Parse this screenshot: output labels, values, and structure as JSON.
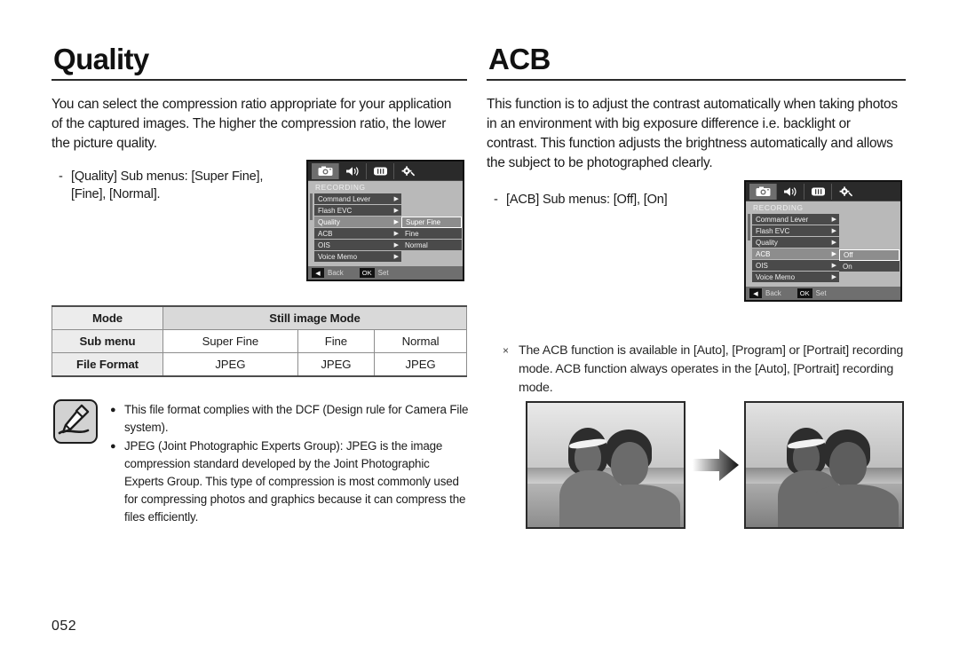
{
  "page": {
    "number": "052"
  },
  "left_section": {
    "title": "Quality",
    "intro": "You can select the compression ratio appropriate for your application of the captured images. The higher the compression ratio, the lower the picture quality.",
    "dash": "-",
    "submenu_line": "[Quality] Sub menus: [Super Fine], [Fine], [Normal]."
  },
  "right_section": {
    "title": "ACB",
    "intro": "This function is to adjust the contrast automatically when taking photos in an environment with big exposure difference i.e. backlight or contrast. This function adjusts the brightness automatically and allows the subject to be photographed clearly.",
    "dash": "-",
    "submenu_line": "[ACB] Sub menus: [Off], [On]",
    "note_mark": "×",
    "note_text": "The ACB function is available in [Auto], [Program] or [Portrait] recording mode. ACB function always operates in the [Auto], [Portrait] recording mode."
  },
  "lcd_quality": {
    "tabs": [
      {
        "icon": "camera-icon",
        "active": true
      },
      {
        "icon": "sound-icon",
        "active": false
      },
      {
        "icon": "display-icon",
        "active": false
      },
      {
        "icon": "settings-gear-icon",
        "active": false
      }
    ],
    "heading": "RECORDING",
    "rows": [
      {
        "label": "Command Lever",
        "caret": "▶",
        "selected": false
      },
      {
        "label": "Flash EVC",
        "caret": "▶",
        "selected": false
      },
      {
        "label": "Quality",
        "caret": "▶",
        "selected": true
      },
      {
        "label": "ACB",
        "caret": "▶",
        "selected": false
      },
      {
        "label": "OIS",
        "caret": "▶",
        "selected": false
      },
      {
        "label": "Voice Memo",
        "caret": "▶",
        "selected": false
      }
    ],
    "submenu": [
      {
        "label": "Super Fine",
        "selected": true
      },
      {
        "label": "Fine",
        "selected": false
      },
      {
        "label": "Normal",
        "selected": false
      }
    ],
    "footer": {
      "back_key": "◀",
      "back_label": "Back",
      "ok_key": "OK",
      "ok_label": "Set"
    }
  },
  "lcd_acb": {
    "tabs": [
      {
        "icon": "camera-icon",
        "active": true
      },
      {
        "icon": "sound-icon",
        "active": false
      },
      {
        "icon": "display-icon",
        "active": false
      },
      {
        "icon": "settings-gear-icon",
        "active": false
      }
    ],
    "heading": "RECORDING",
    "rows": [
      {
        "label": "Command Lever",
        "caret": "▶",
        "selected": false
      },
      {
        "label": "Flash EVC",
        "caret": "▶",
        "selected": false
      },
      {
        "label": "Quality",
        "caret": "▶",
        "selected": false
      },
      {
        "label": "ACB",
        "caret": "▶",
        "selected": true
      },
      {
        "label": "OIS",
        "caret": "▶",
        "selected": false
      },
      {
        "label": "Voice Memo",
        "caret": "▶",
        "selected": false
      }
    ],
    "submenu": [
      {
        "label": "Off",
        "selected": true
      },
      {
        "label": "On",
        "selected": false
      }
    ],
    "footer": {
      "back_key": "◀",
      "back_label": "Back",
      "ok_key": "OK",
      "ok_label": "Set"
    }
  },
  "spec_table": {
    "row_mode": {
      "label": "Mode",
      "value": "Still image Mode"
    },
    "row_submenu": {
      "label": "Sub menu",
      "values": [
        "Super Fine",
        "Fine",
        "Normal"
      ]
    },
    "row_format": {
      "label": "File Format",
      "values": [
        "JPEG",
        "JPEG",
        "JPEG"
      ]
    }
  },
  "note_box": {
    "icon": "note-pencil-icon",
    "bullet": "●",
    "items": [
      "This file format complies with the DCF (Design rule for Camera File system).",
      "JPEG (Joint Photographic Experts Group): JPEG is the image compression standard developed by the Joint Photographic Experts Group. This type of compression is most commonly used for compressing photos and graphics because it can compress the files efficiently."
    ]
  },
  "photos": {
    "before_caption": "",
    "after_caption": "",
    "arrow": "right-arrow-icon"
  },
  "colors": {
    "text": "#1a1a1a",
    "rule": "#2b2b2b",
    "table_header_bg": "#d9d9d9",
    "table_label_bg": "#ececec",
    "lcd_bg": "#1b1b1b",
    "lcd_panel": "#b9b9b9",
    "lcd_row": "#4a4a4a",
    "lcd_row_selected": "#8d8d8d"
  }
}
